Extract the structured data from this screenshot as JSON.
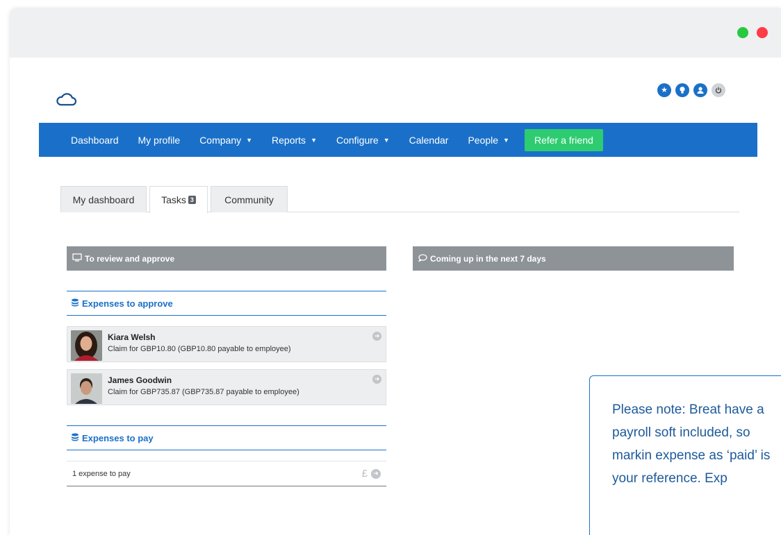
{
  "window": {
    "controls": {
      "green": "#27c93f",
      "red": "#ff3b47"
    }
  },
  "header": {
    "logo_icon": "cloud-icon",
    "icons": [
      "star-icon",
      "lightbulb-icon",
      "user-icon",
      "power-icon"
    ]
  },
  "nav": {
    "items": [
      {
        "label": "Dashboard",
        "caret": false
      },
      {
        "label": "My profile",
        "caret": false
      },
      {
        "label": "Company",
        "caret": true
      },
      {
        "label": "Reports",
        "caret": true
      },
      {
        "label": "Configure",
        "caret": true
      },
      {
        "label": "Calendar",
        "caret": false
      },
      {
        "label": "People",
        "caret": true
      }
    ],
    "cta": "Refer a friend",
    "colors": {
      "bar": "#1a70c9",
      "cta": "#2ecc71"
    }
  },
  "tabs": [
    {
      "label": "My dashboard",
      "active": false
    },
    {
      "label": "Tasks",
      "badge": "3",
      "active": true
    },
    {
      "label": "Community",
      "active": false
    }
  ],
  "left_panel": {
    "title": "To review and approve",
    "icon": "monitor-icon",
    "sections": {
      "approve": {
        "title": "Expenses to approve",
        "icon": "database-icon",
        "rows": [
          {
            "name": "Kiara Welsh",
            "description": "Claim for GBP10.80 (GBP10.80 payable to employee)"
          },
          {
            "name": "James Goodwin",
            "description": "Claim for GBP735.87 (GBP735.87 payable to employee)"
          }
        ]
      },
      "pay": {
        "title": "Expenses to pay",
        "icon": "database-icon",
        "row_text": "1 expense to pay",
        "currency_symbol": "£"
      }
    }
  },
  "right_panel": {
    "title": "Coming up in the next 7 days",
    "icon": "comment-icon"
  },
  "note": {
    "text": "Please note:  Breat have a payroll soft included, so markin expense as ‘paid’ is your reference. Exp"
  }
}
